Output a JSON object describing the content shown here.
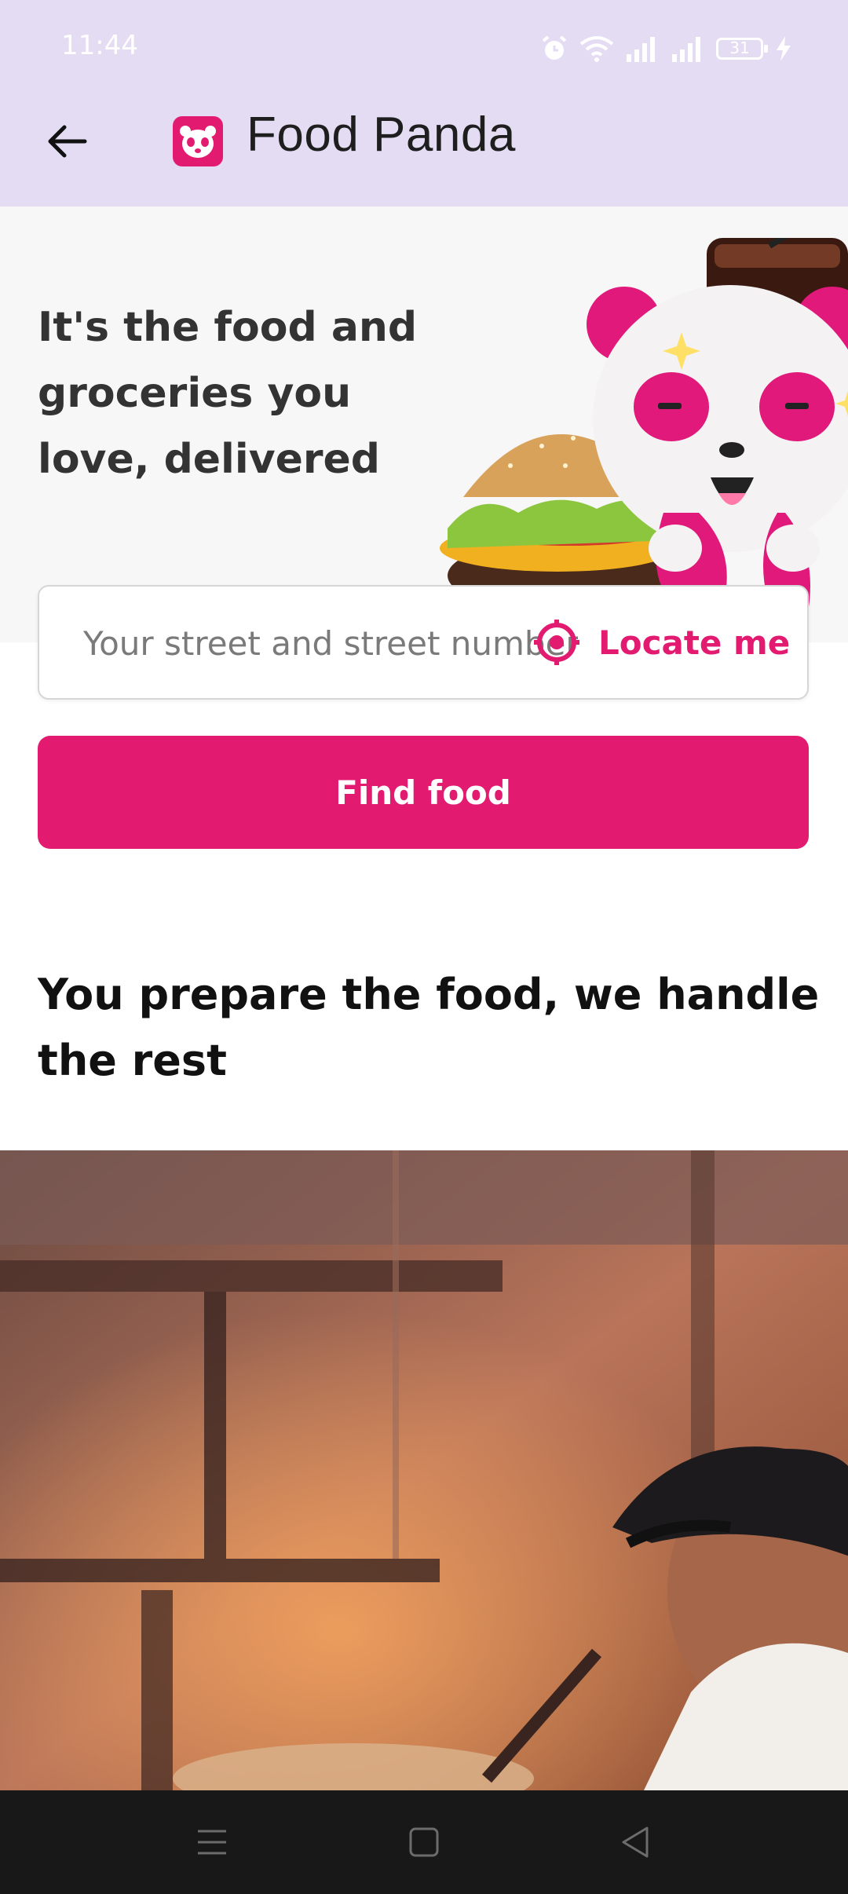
{
  "status_bar": {
    "time": "11:44",
    "battery": "31",
    "icons": [
      "alarm-icon",
      "wifi-icon",
      "signal-icon",
      "signal-icon",
      "battery-icon",
      "charging-icon"
    ]
  },
  "app_bar": {
    "title": "Food Panda",
    "back_icon": "arrow-left-icon",
    "logo_icon": "foodpanda-logo-icon"
  },
  "hero": {
    "headline": "It's the food and groceries you love, delivered"
  },
  "address": {
    "placeholder": "Your street and street number",
    "value": "",
    "locate_label": "Locate me",
    "locate_icon": "crosshair-target-icon"
  },
  "find_button": {
    "label": "Find food"
  },
  "section": {
    "heading": "You prepare the food, we handle the rest"
  },
  "nav_bar": {
    "icons": [
      "menu-icon",
      "home-square-icon",
      "back-triangle-icon"
    ]
  },
  "colors": {
    "brand": "#e21b70",
    "top_bar": "#e4dcf3",
    "hero_bg": "#f7f7f7",
    "nav_bg": "#181818"
  }
}
